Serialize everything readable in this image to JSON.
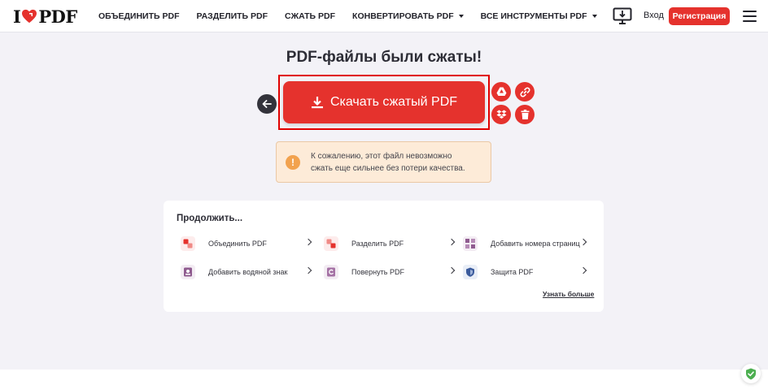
{
  "header": {
    "logo": {
      "left": "I",
      "right": "PDF"
    },
    "nav": [
      {
        "label": "ОБЪЕДИНИТЬ PDF",
        "dropdown": false
      },
      {
        "label": "РАЗДЕЛИТЬ PDF",
        "dropdown": false
      },
      {
        "label": "СЖАТЬ PDF",
        "dropdown": false
      },
      {
        "label": "КОНВЕРТИРОВАТЬ PDF",
        "dropdown": true
      },
      {
        "label": "ВСЕ ИНСТРУМЕНТЫ PDF",
        "dropdown": true
      }
    ],
    "login": "Вход",
    "signup": "Регистрация"
  },
  "main": {
    "title": "PDF-файлы были сжаты!",
    "download_label": "Скачать сжатый PDF",
    "warning_line1": "К сожалению, этот файл невозможно",
    "warning_line2": "сжать еще сильнее без потери качества.",
    "warning_icon_glyph": "!"
  },
  "continue": {
    "title": "Продолжить...",
    "tools": [
      {
        "label": "Объединить PDF",
        "icon": "merge-pdf-icon",
        "color": "#e5322d"
      },
      {
        "label": "Разделить PDF",
        "icon": "split-pdf-icon",
        "color": "#e5322d"
      },
      {
        "label": "Добавить номера страниц",
        "icon": "page-numbers-icon",
        "color": "#8f5b8f"
      },
      {
        "label": "Добавить водяной знак",
        "icon": "watermark-icon",
        "color": "#8f5b8f"
      },
      {
        "label": "Повернуть PDF",
        "icon": "rotate-pdf-icon",
        "color": "#8f5b8f"
      },
      {
        "label": "Защита PDF",
        "icon": "protect-pdf-icon",
        "color": "#3b5b9c"
      }
    ],
    "more": "Узнать больше"
  },
  "colors": {
    "brand": "#e5322d",
    "warning_bg": "#fdebd8",
    "warning_icon": "#f2a24e"
  }
}
